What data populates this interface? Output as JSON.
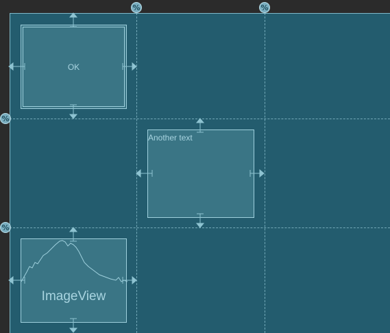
{
  "editor": {
    "percent_symbol": "%",
    "guides": {
      "vertical": [
        "percent-guide-1",
        "percent-guide-2"
      ],
      "horizontal": [
        "percent-guide-1",
        "percent-guide-2"
      ]
    }
  },
  "widgets": {
    "button": {
      "label": "OK",
      "type": "Button"
    },
    "textview": {
      "label": "Another text",
      "type": "TextView"
    },
    "imageview": {
      "label": "ImageView",
      "type": "ImageView"
    }
  },
  "colors": {
    "background": "#235c6e",
    "widget_fill": "#3a7585",
    "widget_border": "#9fd0dd",
    "guide": "#8ec3d1",
    "handle": "#7aaec0"
  }
}
